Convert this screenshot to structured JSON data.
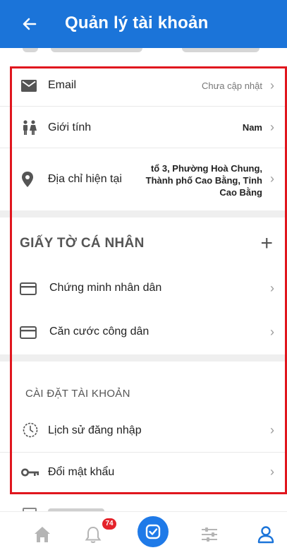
{
  "header": {
    "title": "Quản lý tài khoản",
    "back_icon": "arrow-left-icon"
  },
  "colors": {
    "primary": "#1b74d9",
    "highlight": "#e0161e",
    "badge": "#e4232b",
    "active_tab": "#1b74d9"
  },
  "profile_rows": [
    {
      "label": "Email",
      "value": "Chưa cập nhật",
      "icon": "email-icon"
    },
    {
      "label": "Giới tính",
      "value": "Nam",
      "icon": "gender-icon"
    },
    {
      "label": "Địa chỉ hiện tại",
      "value": "tổ 3, Phường Hoà Chung, Thành phố Cao Bằng, Tỉnh Cao Bằng",
      "icon": "location-pin-icon"
    }
  ],
  "documents": {
    "title": "GIẤY TỜ CÁ NHÂN",
    "add_label": "+",
    "items": [
      {
        "label": "Chứng minh nhân dân",
        "icon": "id-card-icon"
      },
      {
        "label": "Căn cước công dân",
        "icon": "id-card-icon"
      }
    ]
  },
  "settings": {
    "title": "CÀI ĐẶT TÀI KHOẢN",
    "items": [
      {
        "label": "Lịch sử đăng nhập",
        "icon": "history-clock-icon"
      },
      {
        "label": "Đổi mật khẩu",
        "icon": "key-icon"
      }
    ]
  },
  "bottom_nav": {
    "notification_count": "74",
    "tabs": [
      "home-icon",
      "bell-icon",
      "check-badge-icon",
      "sliders-icon",
      "user-icon"
    ],
    "active": "user-icon"
  }
}
